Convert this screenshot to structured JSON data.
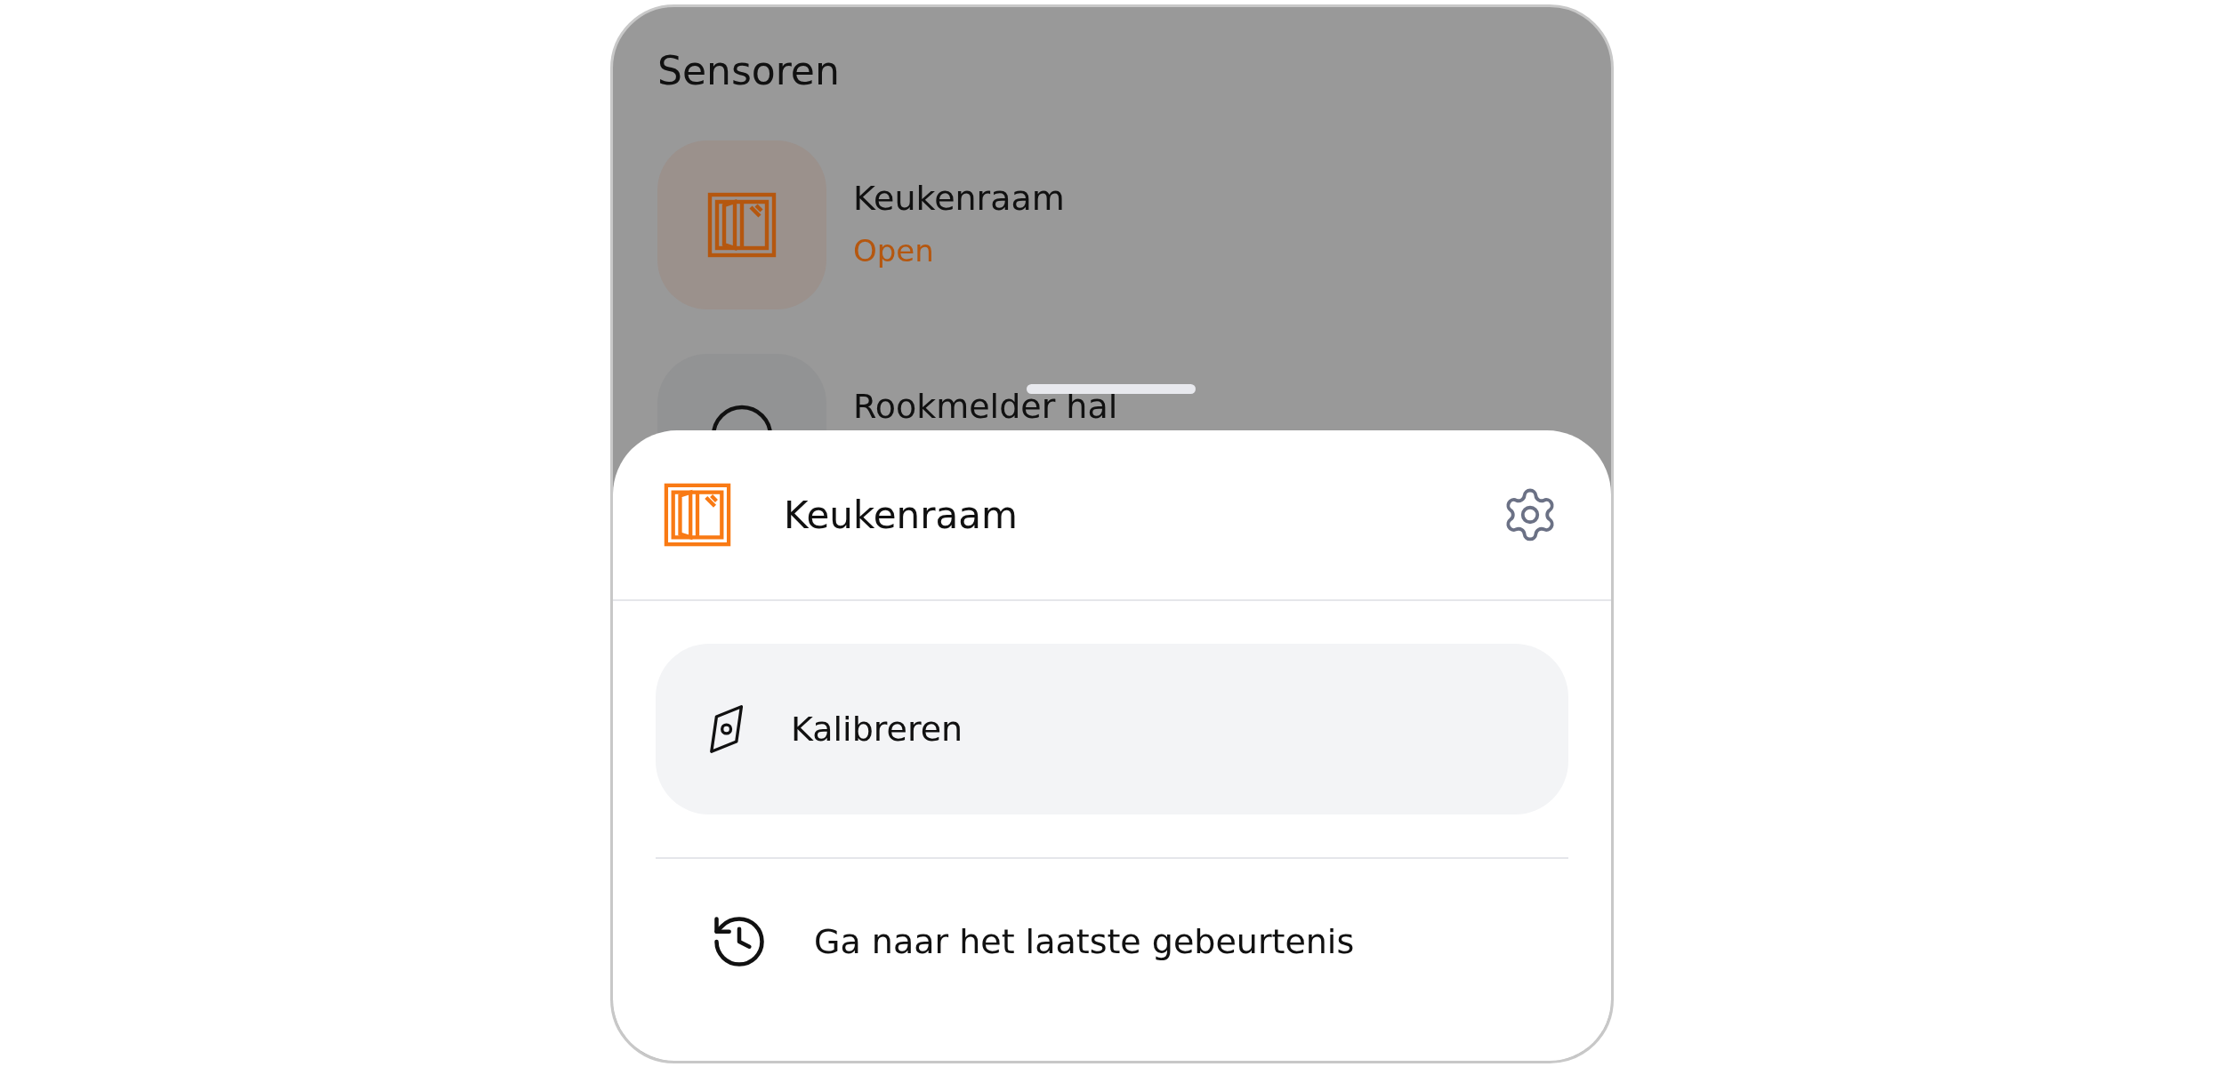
{
  "screen": {
    "title": "Sensoren"
  },
  "sensors": [
    {
      "name": "Keukenraam",
      "status": "Open",
      "kind": "window"
    },
    {
      "name": "Rookmelder hal",
      "kind": "smoke"
    }
  ],
  "sheet": {
    "title": "Keukenraam",
    "kind": "window",
    "actions": [
      {
        "label": "Kalibreren",
        "kind": "compass",
        "highlighted": true
      },
      {
        "label": "Ga naar het laatste gebeurtenis",
        "kind": "history",
        "highlighted": false
      }
    ]
  }
}
